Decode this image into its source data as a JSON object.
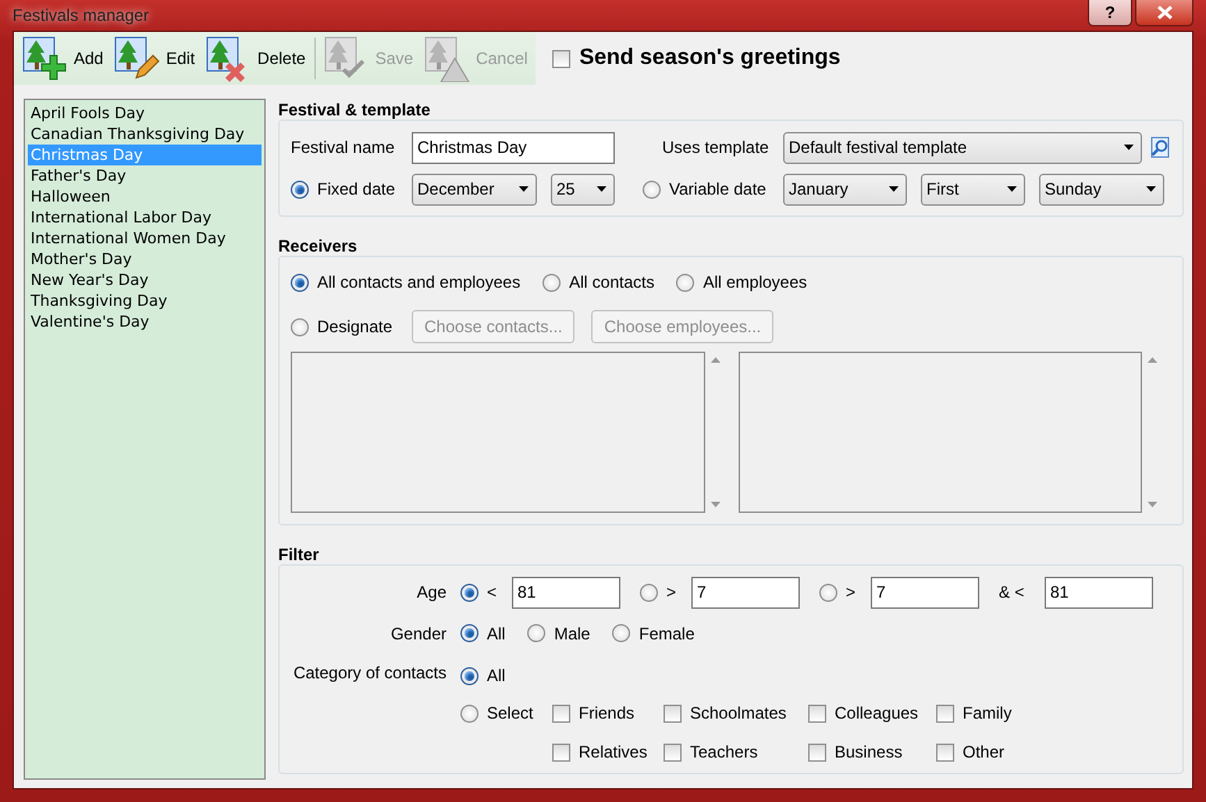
{
  "window": {
    "title": "Festivals manager",
    "help": "?"
  },
  "toolbar": {
    "buttons": [
      {
        "label": "Add",
        "kind": "add",
        "disabled": false
      },
      {
        "label": "Edit",
        "kind": "edit",
        "disabled": false
      },
      {
        "label": "Delete",
        "kind": "delete",
        "disabled": false
      },
      {
        "label": "Save",
        "kind": "save",
        "disabled": true
      },
      {
        "label": "Cancel",
        "kind": "cancel",
        "disabled": true
      }
    ],
    "greetings": {
      "label": "Send season's greetings",
      "checked": false
    }
  },
  "festivals": [
    {
      "name": "April Fools Day",
      "selected": false
    },
    {
      "name": "Canadian Thanksgiving Day",
      "selected": false
    },
    {
      "name": "Christmas Day",
      "selected": true
    },
    {
      "name": "Father's Day",
      "selected": false
    },
    {
      "name": "Halloween",
      "selected": false
    },
    {
      "name": "International Labor Day",
      "selected": false
    },
    {
      "name": "International Women Day",
      "selected": false
    },
    {
      "name": "Mother's Day",
      "selected": false
    },
    {
      "name": "New Year's Day",
      "selected": false
    },
    {
      "name": "Thanksgiving Day",
      "selected": false
    },
    {
      "name": "Valentine's Day",
      "selected": false
    }
  ],
  "festival_template": {
    "title": "Festival & template",
    "name_label": "Festival name",
    "name_value": "Christmas Day",
    "template_label": "Uses template",
    "template_value": "Default festival template",
    "fixed": {
      "label": "Fixed date",
      "selected": true,
      "month": "December",
      "day": "25"
    },
    "variable": {
      "label": "Variable date",
      "selected": false,
      "month": "January",
      "ordinal": "First",
      "weekday": "Sunday"
    }
  },
  "receivers": {
    "title": "Receivers",
    "options": [
      {
        "label": "All contacts and employees",
        "selected": true
      },
      {
        "label": "All contacts",
        "selected": false
      },
      {
        "label": "All employees",
        "selected": false
      }
    ],
    "designate": {
      "label": "Designate",
      "selected": false
    },
    "buttons": [
      {
        "label": "Choose contacts...",
        "disabled": true
      },
      {
        "label": "Choose employees...",
        "disabled": true
      }
    ]
  },
  "filter": {
    "title": "Filter",
    "age": {
      "label": "Age",
      "options": [
        {
          "kind": "radio",
          "label": "<",
          "selected": true,
          "value": "81"
        },
        {
          "kind": "radio",
          "label": ">",
          "selected": false,
          "value": "7"
        },
        {
          "kind": "radio",
          "label": ">",
          "selected": false,
          "value": "7"
        },
        {
          "kind": "plain",
          "label": "& <",
          "value": "81"
        }
      ]
    },
    "gender": {
      "label": "Gender",
      "options": [
        {
          "label": "All",
          "selected": true
        },
        {
          "label": "Male",
          "selected": false
        },
        {
          "label": "Female",
          "selected": false
        }
      ]
    },
    "category": {
      "label": "Category of contacts",
      "options": [
        {
          "label": "All",
          "selected": true
        },
        {
          "label": "Select",
          "selected": false
        }
      ],
      "checks": [
        {
          "label": "Friends",
          "checked": false
        },
        {
          "label": "Schoolmates",
          "checked": false
        },
        {
          "label": "Colleagues",
          "checked": false
        },
        {
          "label": "Family",
          "checked": false
        },
        {
          "label": "Relatives",
          "checked": false
        },
        {
          "label": "Teachers",
          "checked": false
        },
        {
          "label": "Business",
          "checked": false
        },
        {
          "label": "Other",
          "checked": false
        }
      ]
    }
  }
}
